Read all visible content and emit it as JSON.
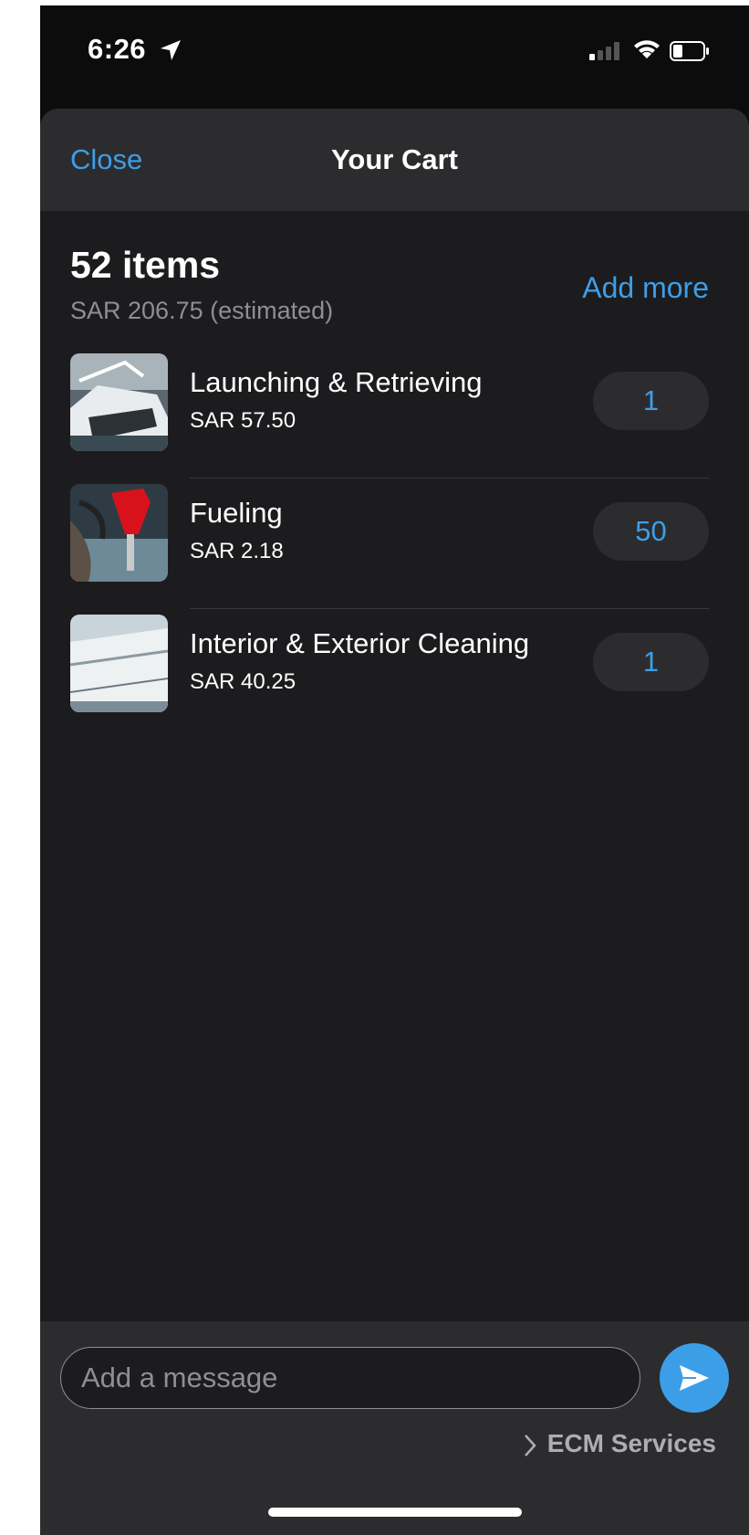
{
  "status_bar": {
    "time": "6:26"
  },
  "header": {
    "close_label": "Close",
    "title": "Your Cart"
  },
  "summary": {
    "count_label": "52 items",
    "total_label": "SAR 206.75 (estimated)",
    "add_more_label": "Add more"
  },
  "items": [
    {
      "name": "Launching & Retrieving",
      "price": "SAR 57.50",
      "quantity": "1",
      "image": "boat-launch-photo"
    },
    {
      "name": "Fueling",
      "price": "SAR 2.18",
      "quantity": "50",
      "image": "fuel-nozzle-photo"
    },
    {
      "name": "Interior & Exterior Cleaning",
      "price": "SAR 40.25",
      "quantity": "1",
      "image": "boat-cleaning-photo"
    }
  ],
  "composer": {
    "placeholder": "Add a message",
    "service_label": "ECM Services"
  },
  "colors": {
    "accent": "#3d9ee8",
    "sheet_background": "#1c1c1e",
    "header_background": "#2c2c2e"
  }
}
